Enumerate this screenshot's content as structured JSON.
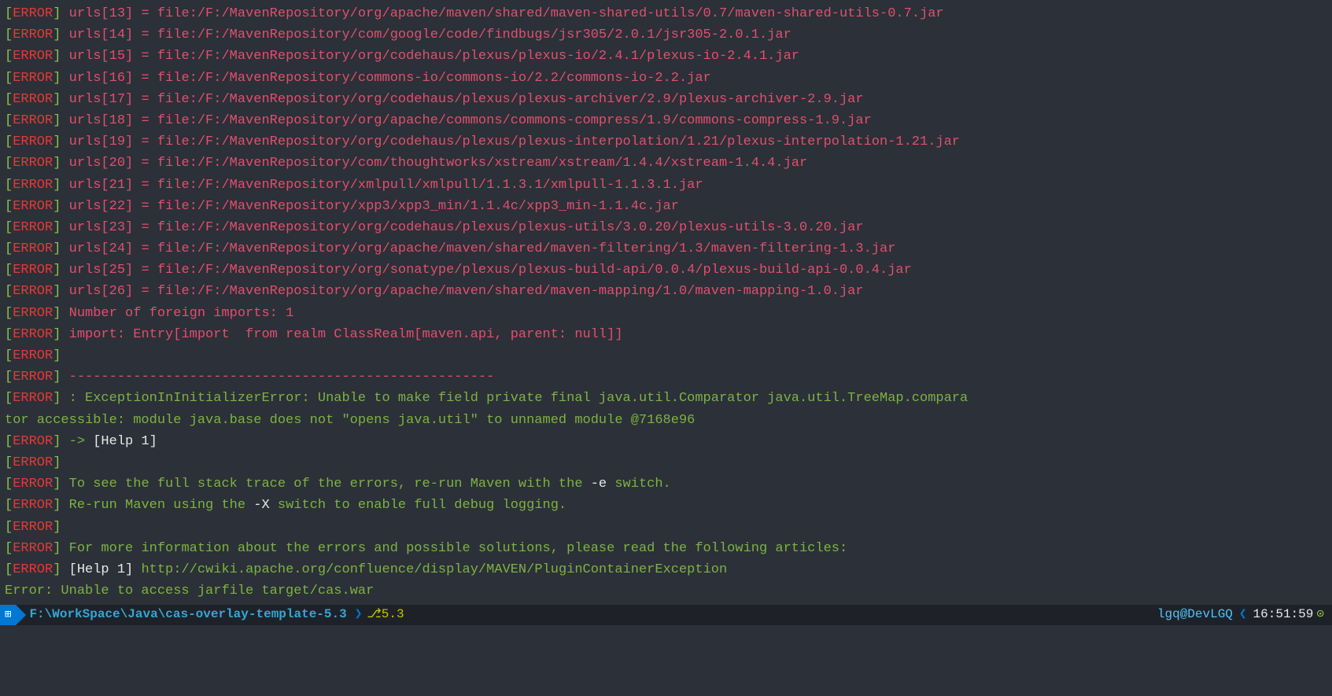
{
  "tag_open": "[",
  "tag_label": "ERROR",
  "tag_close": "] ",
  "urls": [
    "urls[13] = file:/F:/MavenRepository/org/apache/maven/shared/maven-shared-utils/0.7/maven-shared-utils-0.7.jar",
    "urls[14] = file:/F:/MavenRepository/com/google/code/findbugs/jsr305/2.0.1/jsr305-2.0.1.jar",
    "urls[15] = file:/F:/MavenRepository/org/codehaus/plexus/plexus-io/2.4.1/plexus-io-2.4.1.jar",
    "urls[16] = file:/F:/MavenRepository/commons-io/commons-io/2.2/commons-io-2.2.jar",
    "urls[17] = file:/F:/MavenRepository/org/codehaus/plexus/plexus-archiver/2.9/plexus-archiver-2.9.jar",
    "urls[18] = file:/F:/MavenRepository/org/apache/commons/commons-compress/1.9/commons-compress-1.9.jar",
    "urls[19] = file:/F:/MavenRepository/org/codehaus/plexus/plexus-interpolation/1.21/plexus-interpolation-1.21.jar",
    "urls[20] = file:/F:/MavenRepository/com/thoughtworks/xstream/xstream/1.4.4/xstream-1.4.4.jar",
    "urls[21] = file:/F:/MavenRepository/xmlpull/xmlpull/1.1.3.1/xmlpull-1.1.3.1.jar",
    "urls[22] = file:/F:/MavenRepository/xpp3/xpp3_min/1.1.4c/xpp3_min-1.1.4c.jar",
    "urls[23] = file:/F:/MavenRepository/org/codehaus/plexus/plexus-utils/3.0.20/plexus-utils-3.0.20.jar",
    "urls[24] = file:/F:/MavenRepository/org/apache/maven/shared/maven-filtering/1.3/maven-filtering-1.3.jar",
    "urls[25] = file:/F:/MavenRepository/org/sonatype/plexus/plexus-build-api/0.0.4/plexus-build-api-0.0.4.jar",
    "urls[26] = file:/F:/MavenRepository/org/apache/maven/shared/maven-mapping/1.0/maven-mapping-1.0.jar"
  ],
  "foreign": "Number of foreign imports: 1",
  "import_line": "import: Entry[import  from realm ClassRealm[maven.api, parent: null]]",
  "divider": "-----------------------------------------------------",
  "exception_part1": ": ExceptionInInitializerError: Unable to make field private final java.util.Comparator java.util.TreeMap.compara",
  "exception_part2": "tor accessible: module java.base does not \"opens java.util\" to unnamed module @7168e96",
  "arrow": "-> ",
  "help1_white": "[Help 1]",
  "tip_stack_a": "To see the full stack trace of the errors, re-run Maven with the ",
  "tip_stack_b": "-e",
  "tip_stack_c": " switch.",
  "tip_debug_a": "Re-run Maven using the ",
  "tip_debug_b": "-X",
  "tip_debug_c": " switch to enable full debug logging.",
  "more_info": "For more information about the errors and possible solutions, please read the following articles:",
  "help1_white2": "[Help 1] ",
  "help_url": "http://cwiki.apache.org/confluence/display/MAVEN/PluginContainerException",
  "final_error": "Error: Unable to access jarfile target/cas.war",
  "statusbar": {
    "win_icon": "⊞",
    "path": "F:\\WorkSpace\\Java\\cas-overlay-template-5.3",
    "branch_icon": "⎇",
    "branch": "5.3",
    "user": "lgq@DevLGQ",
    "time": "16:51:59",
    "clock": "⊙"
  }
}
